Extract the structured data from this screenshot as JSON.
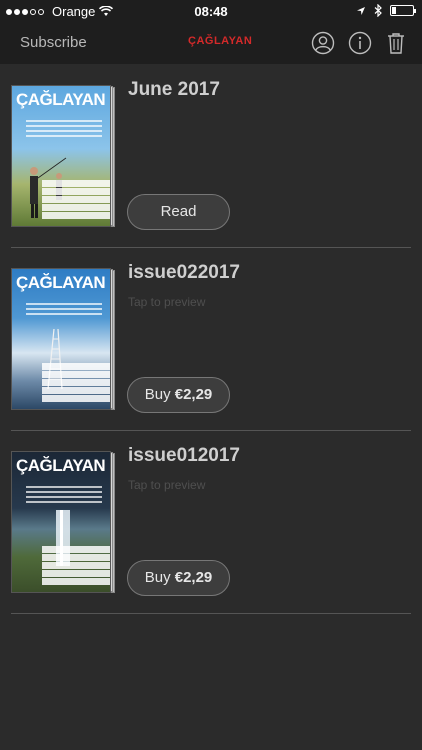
{
  "status_bar": {
    "carrier": "Orange",
    "time": "08:48",
    "icons": [
      "signal-dots-icon",
      "wifi-icon",
      "location-arrow-icon",
      "bluetooth-icon",
      "battery-icon"
    ]
  },
  "nav_bar": {
    "subscribe_label": "Subscribe",
    "brand": "ÇAĞLAYAN",
    "icons": [
      "profile-icon",
      "info-icon",
      "trash-icon"
    ]
  },
  "issues": [
    {
      "title": "June 2017",
      "subtitle": "",
      "cover_masthead": "ÇAĞLAYAN",
      "action_label": "Read",
      "price": "",
      "cover_colors": [
        "#6fb2e2",
        "#8fa35a"
      ]
    },
    {
      "title": "issue022017",
      "subtitle": "Tap to preview",
      "cover_masthead": "ÇAĞLAYAN",
      "action_label": "Buy",
      "price": "€2,29",
      "cover_colors": [
        "#2f7dc4",
        "#e7eef5"
      ]
    },
    {
      "title": "issue012017",
      "subtitle": "Tap to preview",
      "cover_masthead": "ÇAĞLAYAN",
      "action_label": "Buy",
      "price": "€2,29",
      "cover_colors": [
        "#1d2b3a",
        "#4f6a3a"
      ]
    }
  ],
  "colors": {
    "background": "#2b2b2b",
    "bar": "#1e1e1e",
    "brand_red": "#d42a2a",
    "divider": "#555555"
  }
}
